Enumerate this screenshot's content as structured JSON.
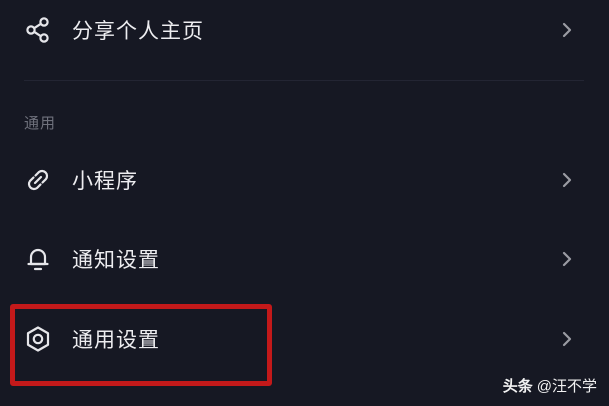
{
  "menu": {
    "share_profile": {
      "label": "分享个人主页",
      "icon": "share-icon"
    },
    "section_general": "通用",
    "mini_program": {
      "label": "小程序",
      "icon": "link-icon"
    },
    "notification_settings": {
      "label": "通知设置",
      "icon": "bell-icon"
    },
    "general_settings": {
      "label": "通用设置",
      "icon": "gear-icon"
    }
  },
  "watermark": {
    "brand": "头条",
    "author": "@汪不学"
  },
  "colors": {
    "background": "#161823",
    "highlight_border": "#c3191a",
    "section_label": "#6f717c"
  }
}
